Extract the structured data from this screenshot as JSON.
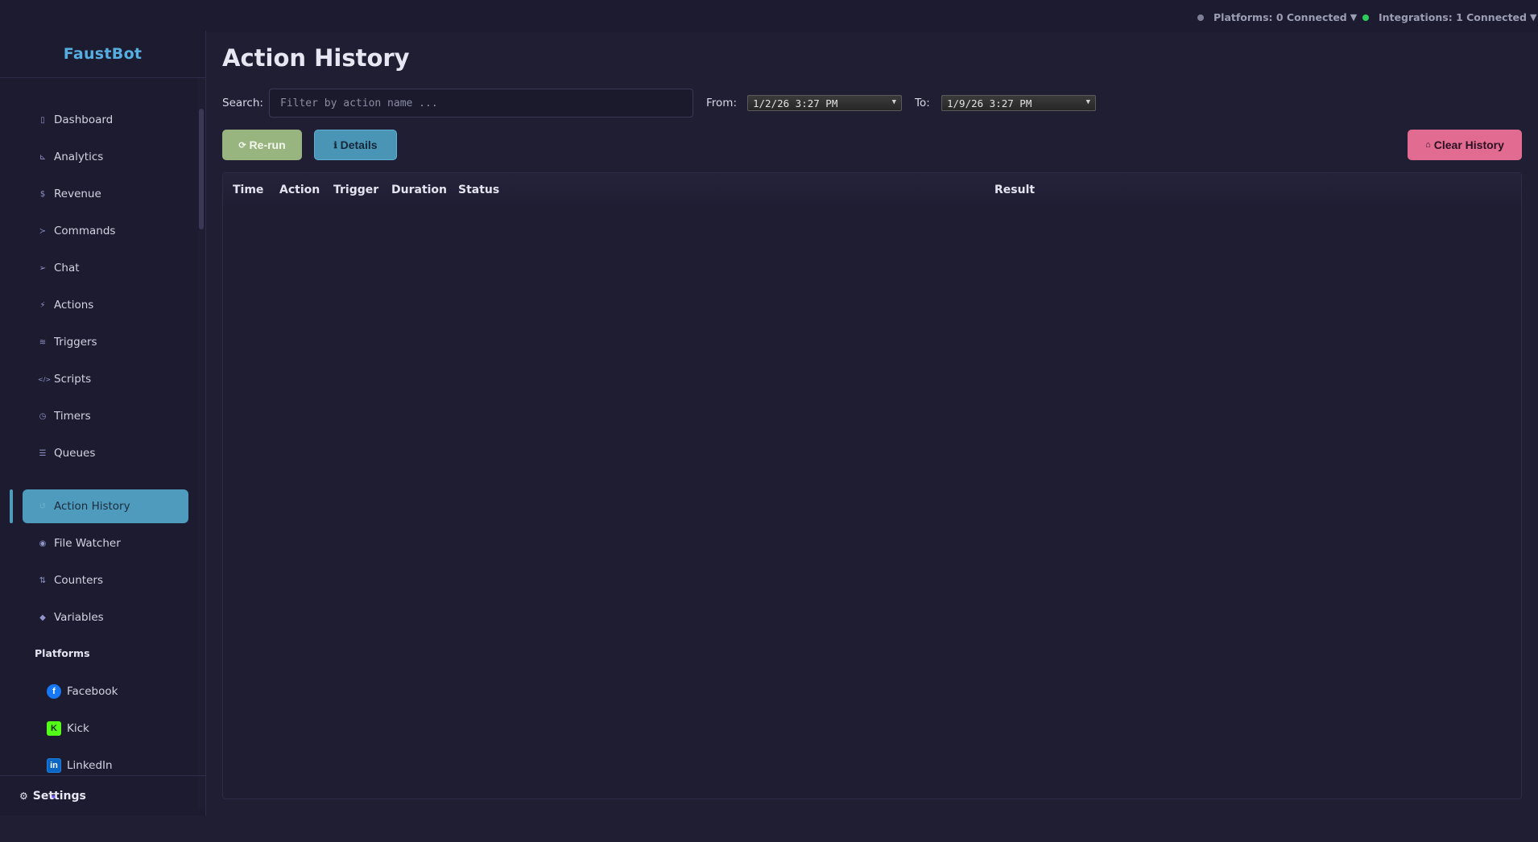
{
  "topbar": {
    "platforms": {
      "label": "Platforms: 0 Connected",
      "dot_color": "#7c7f97",
      "caret": "▼"
    },
    "integrations": {
      "label": "Integrations: 1 Connected",
      "dot_color": "#2ecc5a",
      "caret": "▼"
    }
  },
  "sidebar": {
    "brand": "FaustBot",
    "items": [
      {
        "label": "Dashboard",
        "icon": "document-icon",
        "glyph": "▯"
      },
      {
        "label": "Analytics",
        "icon": "chart-icon",
        "glyph": "⊾"
      },
      {
        "label": "Revenue",
        "icon": "dollar-icon",
        "glyph": "$"
      },
      {
        "label": "Commands",
        "icon": "terminal-icon",
        "glyph": "≻"
      },
      {
        "label": "Chat",
        "icon": "send-icon",
        "glyph": "➢"
      },
      {
        "label": "Actions",
        "icon": "bolt-icon",
        "glyph": "⚡"
      },
      {
        "label": "Triggers",
        "icon": "wifi-icon",
        "glyph": "≋"
      },
      {
        "label": "Scripts",
        "icon": "code-icon",
        "glyph": "</>"
      },
      {
        "label": "Timers",
        "icon": "clock-icon",
        "glyph": "◷"
      },
      {
        "label": "Queues",
        "icon": "list-icon",
        "glyph": "☰"
      },
      {
        "label": "Action History",
        "icon": "history-icon",
        "glyph": "↺"
      },
      {
        "label": "File Watcher",
        "icon": "eye-icon",
        "glyph": "◉"
      },
      {
        "label": "Counters",
        "icon": "sort-icon",
        "glyph": "⇅"
      },
      {
        "label": "Variables",
        "icon": "cube-icon",
        "glyph": "◆"
      }
    ],
    "active_item": "Action History",
    "platforms_section": "Platforms",
    "platforms": [
      {
        "label": "Facebook",
        "icon": "facebook-icon",
        "glyph": "f"
      },
      {
        "label": "Kick",
        "icon": "kick-icon",
        "glyph": "K"
      },
      {
        "label": "LinkedIn",
        "icon": "linkedin-icon",
        "glyph": "in"
      }
    ],
    "settings": {
      "label": "Settings",
      "glyph": "⚙"
    }
  },
  "main": {
    "title": "Action History",
    "search": {
      "label": "Search:",
      "placeholder": "Filter by action name ...",
      "value": ""
    },
    "from": {
      "label": "From:",
      "value": "1/2/26 3:27 PM"
    },
    "to": {
      "label": "To:",
      "value": "1/9/26 3:27 PM"
    },
    "buttons": {
      "rerun": {
        "label": "Re-run",
        "glyph": "⟳"
      },
      "details": {
        "label": "Details",
        "glyph": "ℹ"
      },
      "clear": {
        "label": "Clear History",
        "glyph": "⌂"
      }
    },
    "table": {
      "columns": [
        "Time",
        "Action",
        "Trigger",
        "Duration",
        "Status",
        "Result"
      ],
      "rows": []
    }
  },
  "colors": {
    "background": "#201e33",
    "accent": "#4e9bbd",
    "brand": "#56aee0",
    "rerun": "#98b57f",
    "clear": "#e26b91"
  }
}
